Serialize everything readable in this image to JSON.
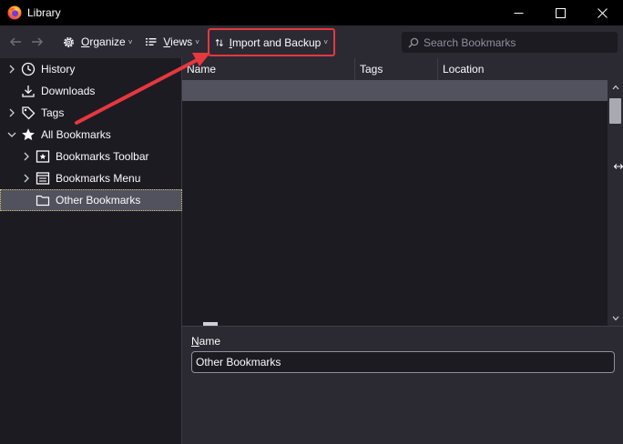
{
  "window": {
    "title": "Library",
    "controls": {
      "minimize": "—",
      "maximize": "☐",
      "close": "✕"
    }
  },
  "toolbar": {
    "back_icon": "arrow-left-icon",
    "forward_icon": "arrow-right-icon",
    "organize": {
      "pre": "",
      "key": "O",
      "post": "rganize",
      "icon": "gear-icon"
    },
    "views": {
      "pre": "",
      "key": "V",
      "post": "iews",
      "icon": "list-icon"
    },
    "import_backup": {
      "pre": "",
      "key": "I",
      "post": "mport and Backup",
      "icon": "sort-arrows-icon"
    },
    "dropdown_glyph": "˅",
    "search_placeholder": "Search Bookmarks"
  },
  "sidebar": {
    "items": [
      {
        "label": "History",
        "icon": "clock-icon",
        "twisty": "›"
      },
      {
        "label": "Downloads",
        "icon": "download-icon",
        "twisty": ""
      },
      {
        "label": "Tags",
        "icon": "tag-icon",
        "twisty": "›"
      },
      {
        "label": "All Bookmarks",
        "icon": "star-icon",
        "twisty": "˅"
      },
      {
        "label": "Bookmarks Toolbar",
        "icon": "bookmark-toolbar-icon",
        "twisty": "›"
      },
      {
        "label": "Bookmarks Menu",
        "icon": "bookmark-menu-icon",
        "twisty": "›"
      },
      {
        "label": "Other Bookmarks",
        "icon": "folder-icon",
        "twisty": ""
      }
    ],
    "selected": "Other Bookmarks"
  },
  "columns": [
    "Name",
    "Tags",
    "Location"
  ],
  "details": {
    "name_label_key": "N",
    "name_label_rest": "ame",
    "name_value": "Other Bookmarks"
  },
  "colors": {
    "accent_red": "#e8373f",
    "titlebar": "#000000",
    "toolbar": "#2b2a33",
    "background": "#1c1b22",
    "selection": "#52525e"
  }
}
